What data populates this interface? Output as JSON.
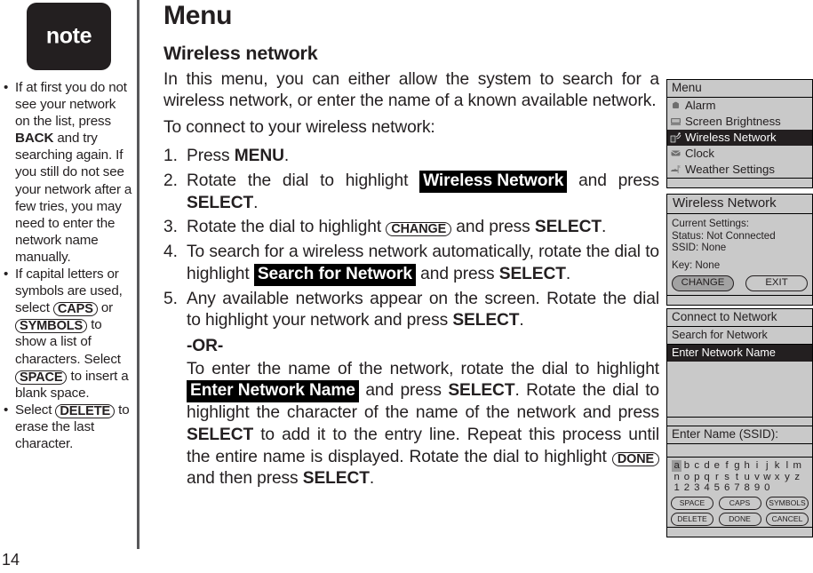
{
  "page": {
    "number": "14",
    "note_badge_label": "note"
  },
  "notes": [
    {
      "id": "note-search-again",
      "segments": [
        {
          "t": "If at first you do not see your network on the list, press ",
          "style": "plain"
        },
        {
          "t": "BACK",
          "style": "bold"
        },
        {
          "t": " and try searching again. If you still do not see your network after a few tries, you may need to enter the network name manually.",
          "style": "plain"
        }
      ]
    },
    {
      "id": "note-caps-symbols",
      "segments": [
        {
          "t": "If capital letters or symbols are used, select ",
          "style": "plain"
        },
        {
          "t": "CAPS",
          "style": "oval"
        },
        {
          "t": " or ",
          "style": "plain"
        },
        {
          "t": "SYMBOLS",
          "style": "oval"
        },
        {
          "t": " to show a list of characters. Select ",
          "style": "plain"
        },
        {
          "t": "SPACE",
          "style": "oval"
        },
        {
          "t": " to insert a blank space.",
          "style": "plain"
        }
      ]
    },
    {
      "id": "note-delete",
      "segments": [
        {
          "t": "Select ",
          "style": "plain"
        },
        {
          "t": "DELETE",
          "style": "oval"
        },
        {
          "t": " to erase the last character.",
          "style": "plain"
        }
      ]
    }
  ],
  "main": {
    "title": "Menu",
    "section_title": "Wireless network",
    "intro_paragraph": "In this menu, you can either allow the system to search for a wireless network, or enter the name of a known available network.",
    "intro_line2": "To connect to your wireless network:",
    "steps": [
      {
        "number": "1.",
        "segments": [
          {
            "t": "Press ",
            "style": "plain"
          },
          {
            "t": "MENU",
            "style": "bold"
          },
          {
            "t": ".",
            "style": "plain"
          }
        ]
      },
      {
        "number": "2.",
        "segments": [
          {
            "t": "Rotate the dial to highlight ",
            "style": "plain"
          },
          {
            "t": "Wireless Network",
            "style": "inverse"
          },
          {
            "t": " and press ",
            "style": "plain"
          },
          {
            "t": "SELECT",
            "style": "bold"
          },
          {
            "t": ".",
            "style": "plain"
          }
        ]
      },
      {
        "number": "3.",
        "segments": [
          {
            "t": "Rotate the dial to highlight ",
            "style": "plain"
          },
          {
            "t": "CHANGE",
            "style": "oval"
          },
          {
            "t": " and press ",
            "style": "plain"
          },
          {
            "t": "SELECT",
            "style": "bold"
          },
          {
            "t": ".",
            "style": "plain"
          }
        ]
      },
      {
        "number": "4.",
        "segments": [
          {
            "t": "To search for a wireless network automatically, rotate the dial to highlight ",
            "style": "plain"
          },
          {
            "t": "Search for Network",
            "style": "inverse"
          },
          {
            "t": " and press ",
            "style": "plain"
          },
          {
            "t": "SELECT",
            "style": "bold"
          },
          {
            "t": ".",
            "style": "plain"
          }
        ]
      },
      {
        "number": "5.",
        "segments": [
          {
            "t": "Any available networks appear on the screen. Rotate the dial to highlight your network and press ",
            "style": "plain"
          },
          {
            "t": "SELECT",
            "style": "bold"
          },
          {
            "t": ".",
            "style": "plain"
          }
        ]
      }
    ],
    "or_label": "-OR-",
    "step5_alt_segments": [
      {
        "t": "To enter the name of the network, rotate the dial to highlight ",
        "style": "plain"
      },
      {
        "t": "Enter Network Name",
        "style": "inverse"
      },
      {
        "t": " and press ",
        "style": "plain"
      },
      {
        "t": "SELECT",
        "style": "bold"
      },
      {
        "t": ". Rotate the dial to highlight the character of the name of the network and press ",
        "style": "plain"
      },
      {
        "t": "SELECT",
        "style": "bold"
      },
      {
        "t": " to add it to the entry line. Repeat this process until the entire name is displayed. Rotate the dial to highlight ",
        "style": "plain"
      },
      {
        "t": "DONE",
        "style": "oval"
      },
      {
        "t": " and then press ",
        "style": "plain"
      },
      {
        "t": "SELECT",
        "style": "bold"
      },
      {
        "t": ".",
        "style": "plain"
      }
    ]
  },
  "screens": {
    "menu_screen": {
      "title": "Menu",
      "items": [
        {
          "label": "Alarm",
          "icon": "alarm-clock-icon",
          "selected": false
        },
        {
          "label": "Screen Brightness",
          "icon": "screen-icon",
          "selected": false
        },
        {
          "label": "Wireless Network",
          "icon": "wireless-icon",
          "selected": true
        },
        {
          "label": "Clock",
          "icon": "clock-icon",
          "selected": false
        },
        {
          "label": "Weather Settings",
          "icon": "weather-icon",
          "selected": false
        }
      ]
    },
    "wireless_screen": {
      "title": "Wireless Network",
      "current_settings_label": "Current Settings:",
      "status_line": "Status: Not Connected",
      "ssid_line": "SSID: None",
      "key_line": "Key: None",
      "buttons": [
        {
          "label": "CHANGE",
          "selected": true
        },
        {
          "label": "EXIT",
          "selected": false
        }
      ]
    },
    "connect_screen": {
      "title": "Connect to Network",
      "items": [
        {
          "label": "Search for Network",
          "selected": false
        },
        {
          "label": "Enter Network Name",
          "selected": true
        }
      ]
    },
    "ssid_screen": {
      "title": "Enter Name (SSID):",
      "entry_value": "",
      "keyboard_rows": [
        [
          "a",
          "b",
          "c",
          "d",
          "e",
          "f",
          "g",
          "h",
          "i",
          "j",
          "k",
          "l",
          "m"
        ],
        [
          "n",
          "o",
          "p",
          "q",
          "r",
          "s",
          "t",
          "u",
          "v",
          "w",
          "x",
          "y",
          "z"
        ],
        [
          "1",
          "2",
          "3",
          "4",
          "5",
          "6",
          "7",
          "8",
          "9",
          "0"
        ]
      ],
      "selected_key": "a",
      "buttons_row1": [
        "SPACE",
        "CAPS",
        "SYMBOLS"
      ],
      "buttons_row2": [
        "DELETE",
        "DONE",
        "CANCEL"
      ]
    }
  },
  "colors": {
    "ink": "#231f20",
    "screen_bg": "#c9c9c9",
    "screen_selected": "#231f20",
    "divider": "#58585a",
    "inverse_bg": "#000000"
  }
}
